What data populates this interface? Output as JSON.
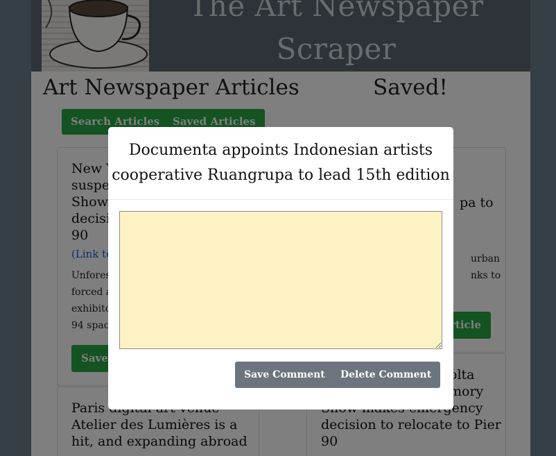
{
  "header": {
    "title_line1": "The Art Newspaper",
    "title_line2": "Scraper"
  },
  "main": {
    "section_title": "Art Newspaper Articles",
    "saved_message": "Saved!",
    "nav": {
      "search_label": "Search Articles",
      "saved_label": "Saved Articles"
    }
  },
  "cards": [
    {
      "title_lines": [
        "New Y",
        "suspen",
        "Show",
        "decisi",
        "90"
      ],
      "link": "(Link to",
      "summary_lines": [
        "Unfores",
        "forced a",
        "exhibito",
        "94 space"
      ],
      "button": "Save"
    },
    {
      "title_fragment": "pa to",
      "summary_lines": [
        "urban",
        "nks to"
      ],
      "button": "rticle"
    },
    {
      "title_lines": [
        "Paris digital art venue",
        "Atelier des Lumières is a",
        "hit, and expanding abroad"
      ]
    },
    {
      "title_lines": [
        "olta",
        "mory",
        "Show makes emergency",
        "decision to relocate to Pier",
        "90"
      ]
    }
  ],
  "modal": {
    "title_line1": "Documenta appoints Indonesian artists",
    "title_line2": "cooperative Ruangrupa to lead 15th edition",
    "comment_value": "",
    "save_label": "Save Comment",
    "delete_label": "Delete Comment"
  },
  "colors": {
    "header_bg": "#5b6670",
    "accent_green": "#28a745",
    "modal_button": "#6c757d",
    "comment_bg": "#fdf2c3"
  }
}
